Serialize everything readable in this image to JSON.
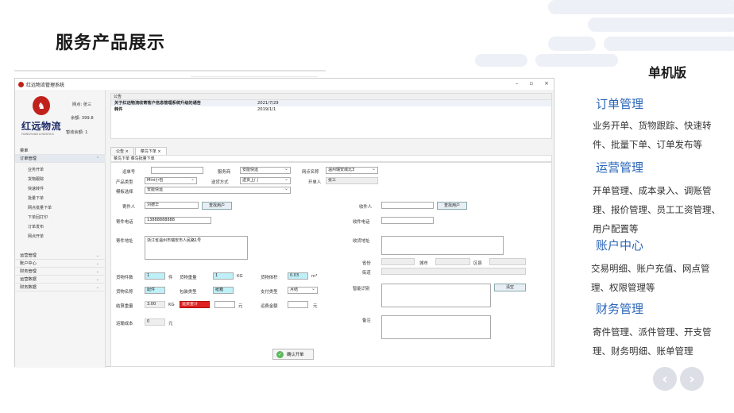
{
  "slide": {
    "title": "服务产品展示"
  },
  "panel": {
    "edition": "单机版",
    "sections": [
      {
        "title": "订单管理",
        "desc1": "业务开单、货物跟踪、快速转",
        "desc2": "件、批量下单、订单发布等"
      },
      {
        "title": "运营管理",
        "desc1": "开单管理、成本录入、调账管",
        "desc2": "理、报价管理、员工工资管理、",
        "desc3": "用户配置等"
      },
      {
        "title": "账户中心",
        "desc1": "交易明细、账户充值、网点管",
        "desc2": "理、权限管理等"
      },
      {
        "title": "财务管理",
        "desc1": "寄件管理、派件管理、开支管",
        "desc2": "理、财务明细、账单管理"
      }
    ],
    "prev_icon": "arrow-left-icon",
    "next_icon": "arrow-right-icon"
  },
  "app": {
    "window_title": "红远物流管理系统",
    "win_buttons": [
      "–",
      "▫",
      "×"
    ],
    "logo": {
      "cn": "红远物流",
      "en": "HONGYUAN LOGISTICS"
    },
    "user": "网点: 张三",
    "balance": "余额: 399.8",
    "deposit": "暂收余额: 1",
    "sidebar": {
      "menu_label": "菜单",
      "active_group": "订单管理",
      "sub_items": [
        "业务开单",
        "货物跟踪",
        "快速转件",
        "批量下单",
        "网点批量下单",
        "下单回打印",
        "订单发布",
        "网点开单"
      ],
      "groups": [
        "运营管理",
        "账户中心",
        "财务管理",
        "运营数据",
        "财务数据"
      ]
    },
    "notice": {
      "header": "公告",
      "rows": [
        {
          "title": "关于红远物流收寄客户信息管理系统升级的通告",
          "date": "2021/7/29"
        },
        {
          "title": "韩件",
          "date": "2019/1/1"
        }
      ]
    },
    "tabs": [
      "公告 ×",
      "菜鸟下单 ×"
    ],
    "subtab": "菜鸟下单  菜鸟批量下单",
    "form": {
      "waybill_label": "运单号",
      "service_label": "服务商",
      "service_value": "安能快运",
      "branch_label": "网点名称",
      "branch_value": "温州瑞安城北3",
      "product_label": "产品类型",
      "product_value": "Mini小包",
      "delivery_label": "送货方式",
      "delivery_value": "送货上门",
      "operator_label": "开单人",
      "operator_value": "张三",
      "template_label": "模板选择",
      "template_value": "安能快运",
      "sender_label": "寄件人",
      "sender_value": "刘德华",
      "find_user": "查找用户",
      "receiver_label": "收件人",
      "sender_phone_label": "寄件电话",
      "sender_phone_value": "13888888888",
      "receiver_phone_label": "收件电话",
      "sender_addr_label": "寄件地址",
      "sender_addr_value": "浙江省温州市瑞安市人民路1号",
      "receiver_addr_label": "收货地址",
      "province_label": "省份",
      "city_label": "城市",
      "district_label": "区县",
      "street_label": "街道",
      "count_label": "货物件数",
      "count_value": "1",
      "count_unit": "件",
      "weight_label": "货物重量",
      "weight_value": "1",
      "weight_unit": "KG",
      "volume_label": "货物体积",
      "volume_value": "0.03",
      "volume_unit": "m³",
      "smart_label": "智能识别",
      "clear_button": "清空",
      "goods_name_label": "货物名称",
      "goods_name_value": "配件",
      "packing_label": "包装类型",
      "packing_value": "纸箱",
      "payment_label": "支付类型",
      "payment_value": "月结",
      "settle_weight_label": "结算重量",
      "settle_weight_value": "3.00",
      "settle_weight_unit": "KG",
      "red_field_value": "运费重计",
      "freight_unit": "元",
      "freight_amount_label": "运费金额",
      "freight_amount_unit": "元",
      "remark_label": "备注",
      "cost_label": "运输成本",
      "cost_value": "0",
      "cost_unit": "元",
      "confirm_button": "确认开单"
    }
  }
}
